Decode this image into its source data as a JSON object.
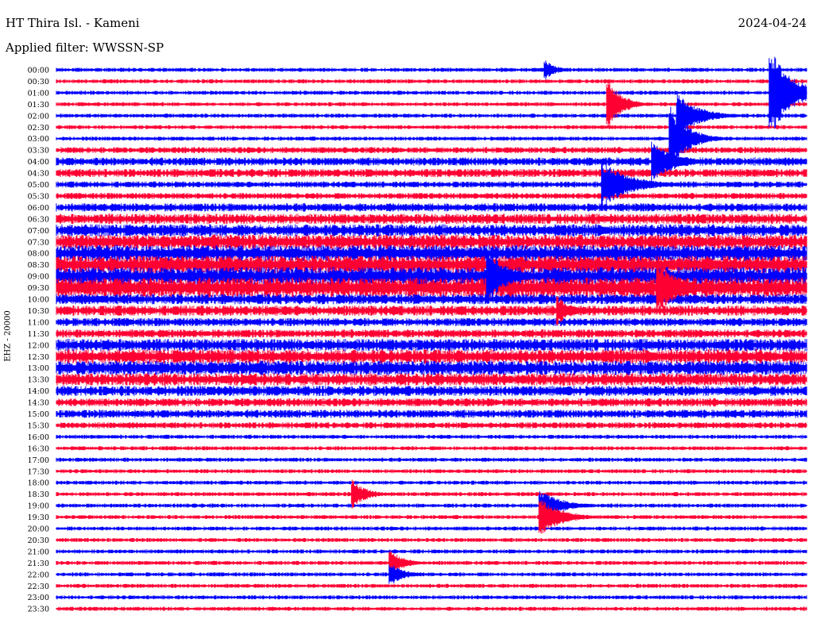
{
  "header": {
    "station": "HT Thira Isl. - Kameni",
    "date": "2024-04-24",
    "filter": "Applied filter: WWSSN-SP"
  },
  "channel_label": "EHZ - 20000",
  "colors": {
    "trace_a": "#0000ff",
    "trace_b": "#ff0033"
  },
  "chart_data": {
    "type": "line",
    "title": "HT Thira Isl. - Kameni",
    "subtitle": "Applied filter: WWSSN-SP",
    "ylabel": "EHZ - 20000",
    "xlabel": "",
    "row_minutes": 30,
    "grid": false,
    "tick_labels": [
      "00:00",
      "00:30",
      "01:00",
      "01:30",
      "02:00",
      "02:30",
      "03:00",
      "03:30",
      "04:00",
      "04:30",
      "05:00",
      "05:30",
      "06:00",
      "06:30",
      "07:00",
      "07:30",
      "08:00",
      "08:30",
      "09:00",
      "09:30",
      "10:00",
      "10:30",
      "11:00",
      "11:30",
      "12:00",
      "12:30",
      "13:00",
      "13:30",
      "14:00",
      "14:30",
      "15:00",
      "15:30",
      "16:00",
      "16:30",
      "17:00",
      "17:30",
      "18:00",
      "18:30",
      "19:00",
      "19:30",
      "20:00",
      "20:30",
      "21:00",
      "21:30",
      "22:00",
      "22:30",
      "23:00",
      "23:30"
    ],
    "row_colors": [
      "blue",
      "red"
    ],
    "noise_level": [
      2,
      2,
      2,
      2,
      2,
      2,
      2,
      3,
      4,
      4,
      3,
      3,
      4,
      5,
      6,
      7,
      8,
      9,
      9,
      10,
      5,
      5,
      4,
      4,
      6,
      7,
      7,
      6,
      5,
      4,
      4,
      3,
      2,
      2,
      2,
      2,
      2,
      2,
      2,
      2,
      2,
      2,
      2,
      2,
      2,
      2,
      2,
      2
    ],
    "events": [
      {
        "row": 0,
        "minute": 19.5,
        "amplitude": 14,
        "duration": 1.5
      },
      {
        "row": 2,
        "minute": 28.5,
        "amplitude": 60,
        "duration": 3
      },
      {
        "row": 3,
        "minute": 22,
        "amplitude": 35,
        "duration": 2
      },
      {
        "row": 4,
        "minute": 24.8,
        "amplitude": 30,
        "duration": 3
      },
      {
        "row": 6,
        "minute": 24.5,
        "amplitude": 45,
        "duration": 2.5
      },
      {
        "row": 8,
        "minute": 23.8,
        "amplitude": 28,
        "duration": 3
      },
      {
        "row": 10,
        "minute": 21.8,
        "amplitude": 30,
        "duration": 4
      },
      {
        "row": 18,
        "minute": 17.2,
        "amplitude": 40,
        "duration": 2.5
      },
      {
        "row": 19,
        "minute": 24,
        "amplitude": 35,
        "duration": 3
      },
      {
        "row": 21,
        "minute": 20,
        "amplitude": 20,
        "duration": 2
      },
      {
        "row": 37,
        "minute": 11.8,
        "amplitude": 20,
        "duration": 2
      },
      {
        "row": 38,
        "minute": 19.3,
        "amplitude": 22,
        "duration": 3
      },
      {
        "row": 39,
        "minute": 19.3,
        "amplitude": 25,
        "duration": 3
      },
      {
        "row": 43,
        "minute": 13.3,
        "amplitude": 18,
        "duration": 2
      },
      {
        "row": 44,
        "minute": 13.3,
        "amplitude": 16,
        "duration": 2
      }
    ]
  }
}
